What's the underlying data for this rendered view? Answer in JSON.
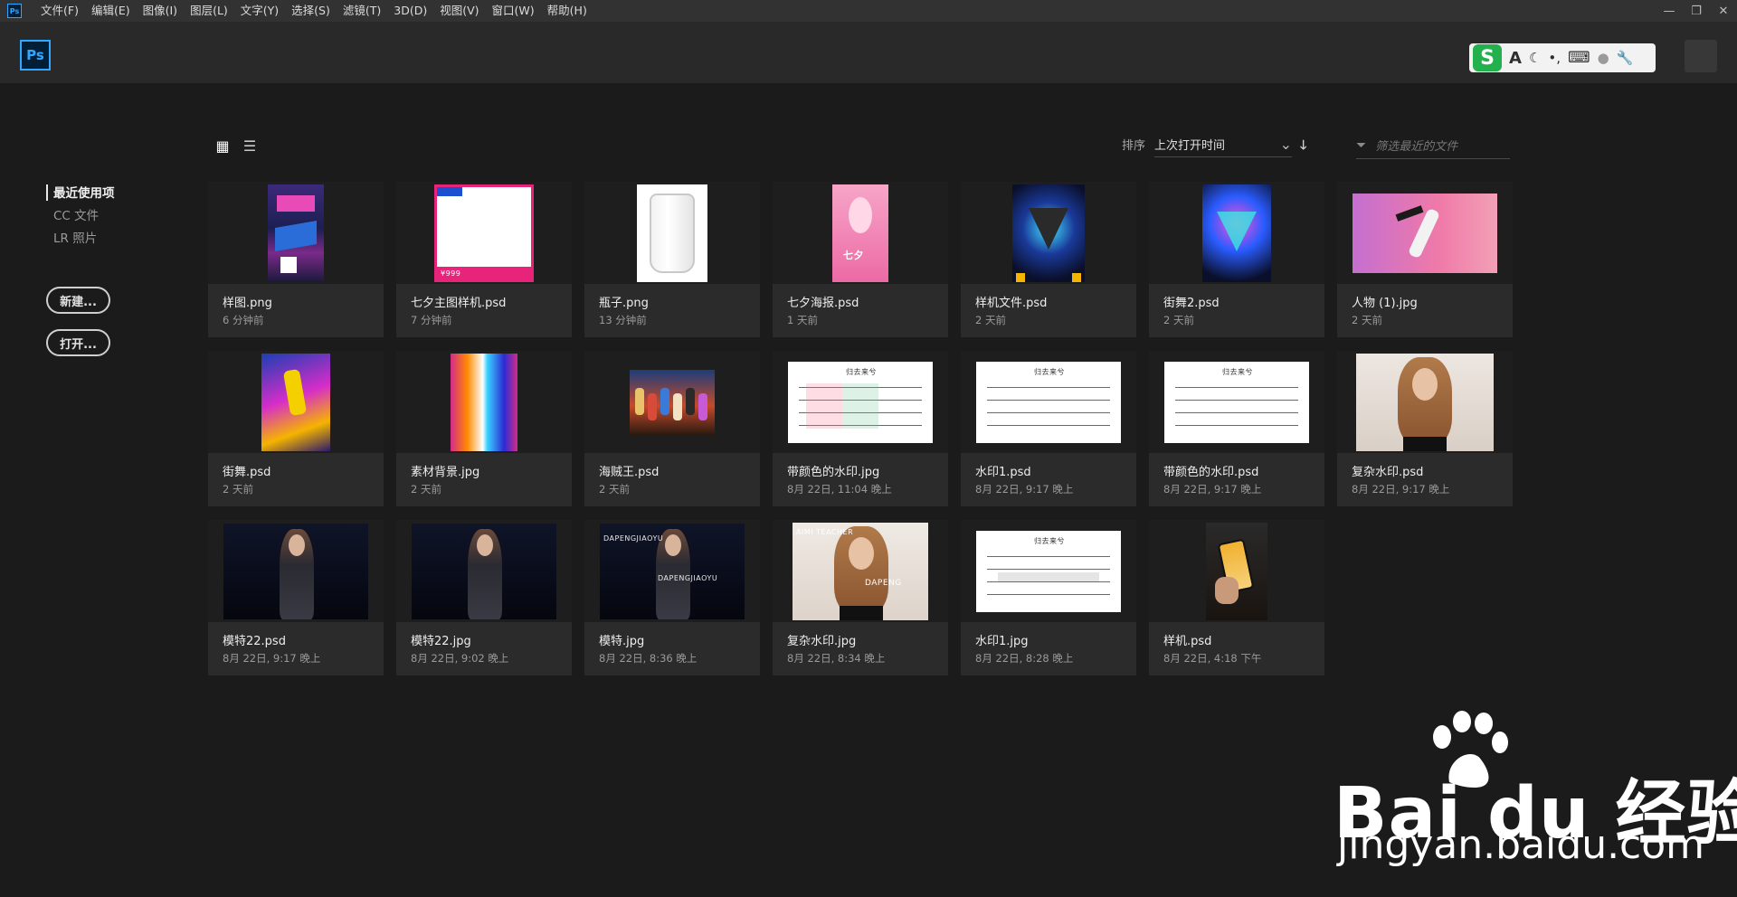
{
  "app": {
    "mini_logo": "Ps",
    "logo": "Ps"
  },
  "menu": [
    "文件(F)",
    "编辑(E)",
    "图像(I)",
    "图层(L)",
    "文字(Y)",
    "选择(S)",
    "滤镜(T)",
    "3D(D)",
    "视图(V)",
    "窗口(W)",
    "帮助(H)"
  ],
  "window_controls": {
    "minimize": "—",
    "restore": "❐",
    "close": "✕"
  },
  "ime": {
    "logo": "S",
    "letter": "A",
    "moon": "☾",
    "punct": "•,",
    "keyboard": "⌨",
    "user": "●",
    "wrench": "🔧"
  },
  "sidebar": {
    "nav": [
      "最近使用项",
      "CC 文件",
      "LR 照片"
    ],
    "new_button": "新建...",
    "open_button": "打开..."
  },
  "toolbar": {
    "grid_icon": "▦",
    "list_icon": "☰",
    "sort_label": "排序",
    "sort_value": "上次打开时间",
    "sort_caret": "⌄",
    "sort_direction": "🡓",
    "filter_icon": "⏷",
    "filter_placeholder": "筛选最近的文件"
  },
  "files": [
    {
      "name": "样图.png",
      "time": "6 分钟前",
      "thumb": "poster-blue"
    },
    {
      "name": "七夕主图样机.psd",
      "time": "7 分钟前",
      "thumb": "poster-white"
    },
    {
      "name": "瓶子.png",
      "time": "13 分钟前",
      "thumb": "jar"
    },
    {
      "name": "七夕海报.psd",
      "time": "1 天前",
      "thumb": "pink"
    },
    {
      "name": "样机文件.psd",
      "time": "2 天前",
      "thumb": "neon"
    },
    {
      "name": "街舞2.psd",
      "time": "2 天前",
      "thumb": "neon2"
    },
    {
      "name": "人物 (1).jpg",
      "time": "2 天前",
      "thumb": "dance"
    },
    {
      "name": "街舞.psd",
      "time": "2 天前",
      "thumb": "hiphop"
    },
    {
      "name": "素材背景.jpg",
      "time": "2 天前",
      "thumb": "burst"
    },
    {
      "name": "海贼王.psd",
      "time": "2 天前",
      "thumb": "onepiece"
    },
    {
      "name": "带颜色的水印.jpg",
      "time": "8月 22日, 11:04 晚上",
      "thumb": "sheet-color"
    },
    {
      "name": "水印1.psd",
      "time": "8月 22日, 9:17 晚上",
      "thumb": "sheet"
    },
    {
      "name": "带颜色的水印.psd",
      "time": "8月 22日, 9:17 晚上",
      "thumb": "sheet"
    },
    {
      "name": "复杂水印.psd",
      "time": "8月 22日, 9:17 晚上",
      "thumb": "woman-light"
    },
    {
      "name": "模特22.psd",
      "time": "8月 22日, 9:17 晚上",
      "thumb": "woman-dark"
    },
    {
      "name": "模特22.jpg",
      "time": "8月 22日, 9:02 晚上",
      "thumb": "woman-dark"
    },
    {
      "name": "模特.jpg",
      "time": "8月 22日, 8:36 晚上",
      "thumb": "woman-dark-text"
    },
    {
      "name": "复杂水印.jpg",
      "time": "8月 22日, 8:34 晚上",
      "thumb": "woman-light-text"
    },
    {
      "name": "水印1.jpg",
      "time": "8月 22日, 8:28 晚上",
      "thumb": "sheet-wm"
    },
    {
      "name": "样机.psd",
      "time": "8月 22日, 4:18 下午",
      "thumb": "phone"
    }
  ],
  "thumb_text": {
    "sheet_title": "归去来兮",
    "dapeng": "DAPENGJIAOYU",
    "aimi": "AIMI TEACHER",
    "dapeng2": "DAPENG",
    "price": "¥999",
    "qixi": "七夕"
  },
  "watermark": {
    "brand": "Bai du 经验",
    "url": "jingyan.baidu.com"
  }
}
